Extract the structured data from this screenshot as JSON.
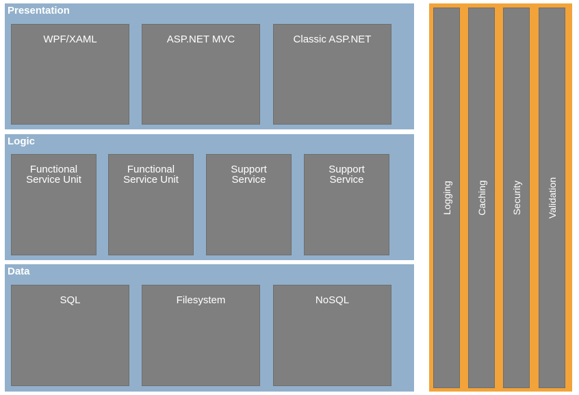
{
  "layers": [
    {
      "title": "Presentation",
      "boxes": [
        "WPF/XAML",
        "ASP.NET MVC",
        "Classic ASP.NET"
      ]
    },
    {
      "title": "Logic",
      "boxes": [
        "Functional\nService Unit",
        "Functional\nService Unit",
        "Support\nService",
        "Support\nService"
      ]
    },
    {
      "title": "Data",
      "boxes": [
        "SQL",
        "Filesystem",
        "NoSQL"
      ]
    }
  ],
  "cross_cutting": {
    "items": [
      "Logging",
      "Caching",
      "Security",
      "Validation"
    ]
  },
  "colors": {
    "layer_background": "#92b0cb",
    "box_fill": "#7f7f7f",
    "cross_cutting_background": "#f2a33a",
    "text": "#ffffff"
  }
}
